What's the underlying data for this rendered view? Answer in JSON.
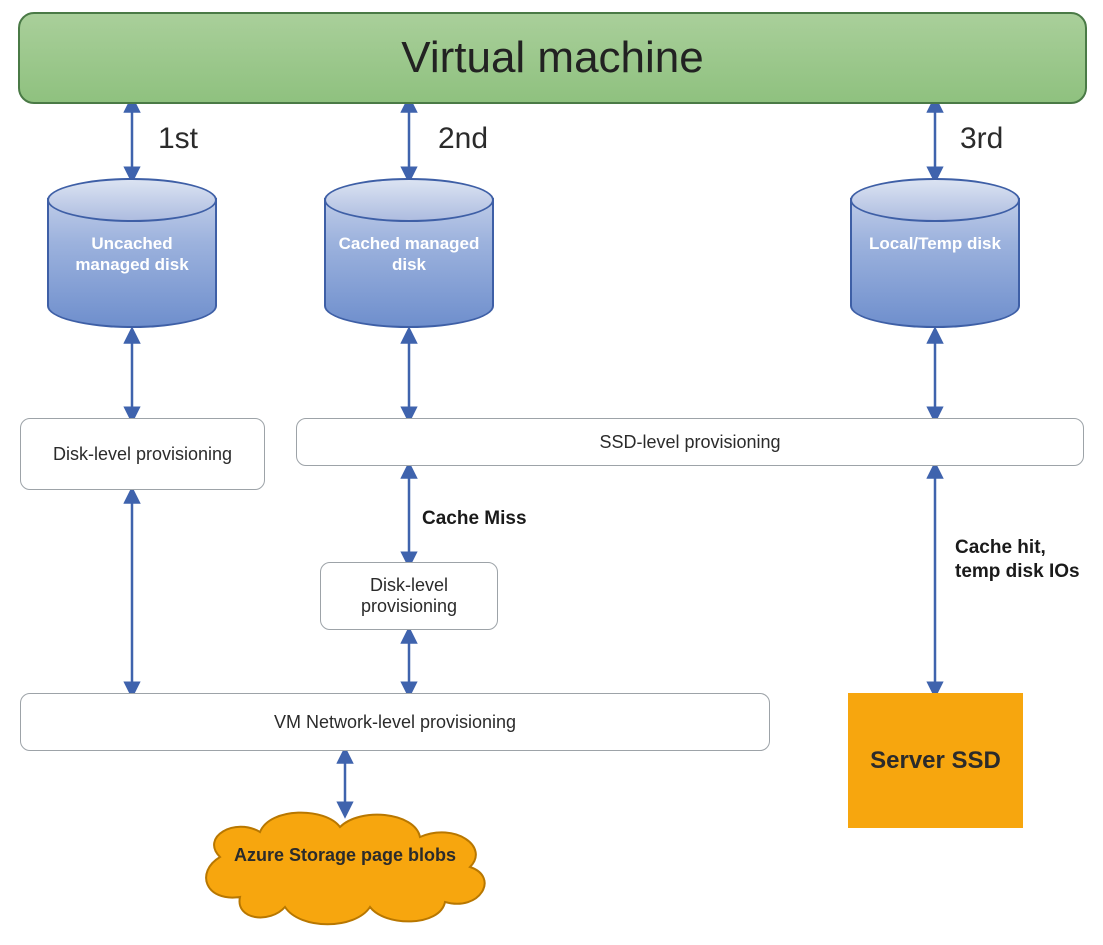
{
  "title": "Virtual machine",
  "paths": {
    "first": {
      "order": "1st"
    },
    "second": {
      "order": "2nd"
    },
    "third": {
      "order": "3rd"
    }
  },
  "disks": {
    "uncached": "Uncached managed disk",
    "cached": "Cached managed disk",
    "local": "Local/Temp disk"
  },
  "boxes": {
    "disk_level": "Disk-level provisioning",
    "disk_level2": "Disk-level provisioning",
    "ssd_level": "SSD-level provisioning",
    "vm_network": "VM Network-level provisioning",
    "server_ssd": "Server SSD"
  },
  "labels": {
    "cache_miss": "Cache Miss",
    "cache_hit": "Cache hit, temp disk IOs"
  },
  "cloud": "Azure Storage page blobs",
  "colors": {
    "arrow": "#3f63ad",
    "orange": "#f7a60e"
  }
}
